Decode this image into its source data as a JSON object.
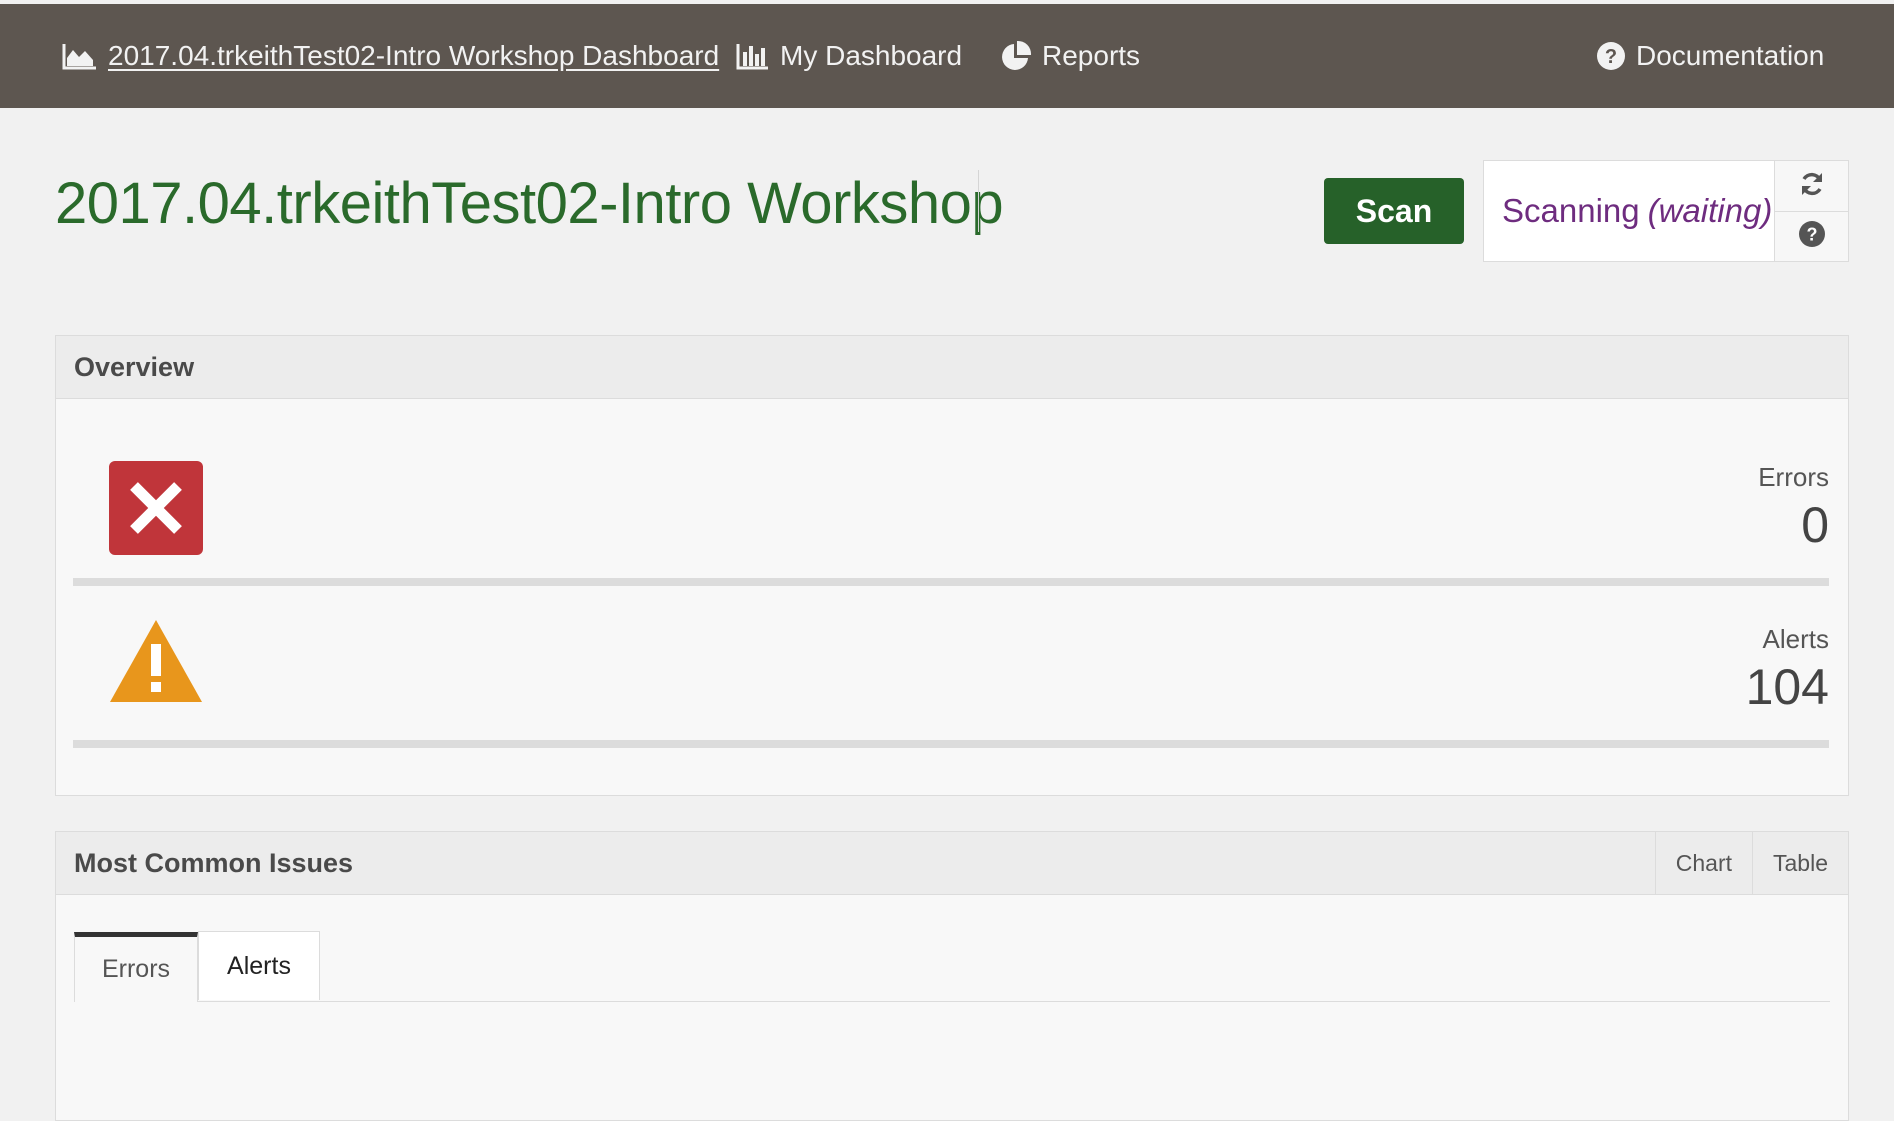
{
  "nav": {
    "home_label": "2017.04.trkeithTest02-Intro Workshop Dashboard",
    "my_dashboard_label": "My Dashboard",
    "reports_label": "Reports",
    "documentation_label": "Documentation"
  },
  "header": {
    "title": "2017.04.trkeithTest02-Intro Workshop",
    "scan_label": "Scan",
    "status_prefix": "Scanning",
    "status_state": "(waiting)"
  },
  "overview": {
    "heading": "Overview",
    "errors": {
      "label": "Errors",
      "value": "0"
    },
    "alerts": {
      "label": "Alerts",
      "value": "104"
    }
  },
  "issues": {
    "heading": "Most Common Issues",
    "view_options": [
      "Chart",
      "Table"
    ],
    "tabs": [
      "Errors",
      "Alerts"
    ]
  },
  "colors": {
    "topbar": "#5d5650",
    "title_green": "#2a6a2b",
    "scan_green": "#266129",
    "status_purple": "#6e2c7f",
    "error_red": "#c0353a",
    "alert_orange": "#e8961c"
  },
  "icons": {
    "home": "area-chart-icon",
    "my_dashboard": "bar-chart-icon",
    "reports": "pie-chart-icon",
    "documentation": "question-circle-icon",
    "refresh": "refresh-icon",
    "help": "question-circle-icon",
    "errors": "error-x-icon",
    "alerts": "warning-triangle-icon"
  }
}
